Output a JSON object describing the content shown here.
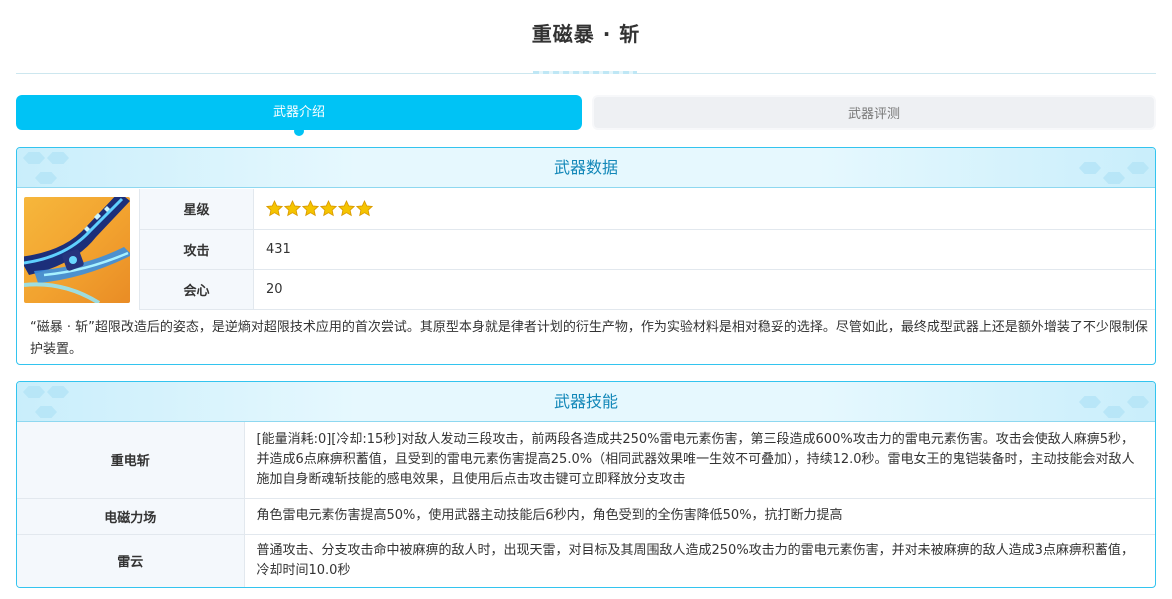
{
  "page": {
    "title": "重磁暴 · 斩"
  },
  "tabs": [
    {
      "label": "武器介绍",
      "active": true
    },
    {
      "label": "武器评测",
      "active": false
    }
  ],
  "weapon_data": {
    "heading": "武器数据",
    "image_icon": "weapon-blade-icon",
    "stats": [
      {
        "label": "星级",
        "value": "",
        "stars": 6
      },
      {
        "label": "攻击",
        "value": "431"
      },
      {
        "label": "会心",
        "value": "20"
      }
    ],
    "description": "“磁暴 · 斩”超限改造后的姿态，是逆熵对超限技术应用的首次尝试。其原型本身就是律者计划的衍生产物，作为实验材料是相对稳妥的选择。尽管如此，最终成型武器上还是额外增装了不少限制保护装置。"
  },
  "weapon_skills": {
    "heading": "武器技能",
    "skills": [
      {
        "name": "重电斩",
        "desc": "[能量消耗:0][冷却:15秒]对敌人发动三段攻击，前两段各造成共250%雷电元素伤害，第三段造成600%攻击力的雷电元素伤害。攻击会使敌人麻痹5秒，并造成6点麻痹积蓄值，且受到的雷电元素伤害提高25.0%（相同武器效果唯一生效不可叠加），持续12.0秒。雷电女王的鬼铠装备时，主动技能会对敌人施加自身断魂斩技能的感电效果，且使用后点击攻击键可立即释放分支攻击"
      },
      {
        "name": "电磁力场",
        "desc": "角色雷电元素伤害提高50%，使用武器主动技能后6秒内，角色受到的全伤害降低50%，抗打断力提高"
      },
      {
        "name": "雷云",
        "desc": "普通攻击、分支攻击命中被麻痹的敌人时，出现天雷，对目标及其周围敌人造成250%攻击力的雷电元素伤害，并对未被麻痹的敌人造成3点麻痹积蓄值，冷却时间10.0秒"
      }
    ]
  },
  "colors": {
    "accent": "#00c3f5",
    "panel_border": "#33c4ef",
    "heading_text": "#1287b8",
    "star": "#f5c400"
  }
}
